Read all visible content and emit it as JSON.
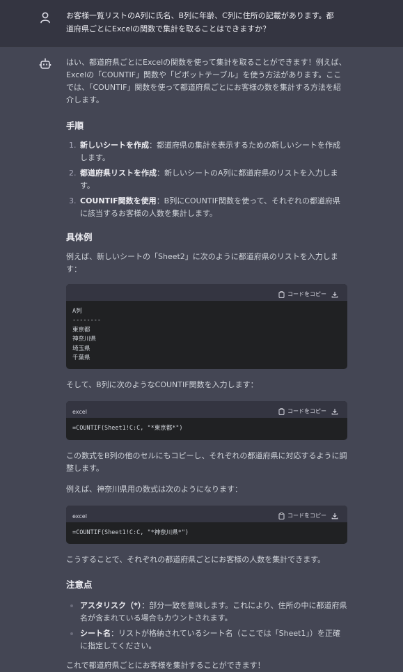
{
  "user_message": {
    "text": "お客様一覧リストのA列に氏名、B列に年齢、C列に住所の記載があります。都道府県ごとにExcelの関数で集計を取ることはできますか？"
  },
  "assistant_message": {
    "intro": "はい、都道府県ごとにExcelの関数を使って集計を取ることができます！例えば、Excelの「COUNTIF」関数や「ピボットテーブル」を使う方法があります。ここでは、「COUNTIF」関数を使って都道府県ごとにお客様の数を集計する方法を紹介します。",
    "steps_heading": "手順",
    "steps": [
      {
        "num": "1.",
        "bold": "新しいシートを作成",
        "text": "：都道府県の集計を表示するための新しいシートを作成します。"
      },
      {
        "num": "2.",
        "bold": "都道府県リストを作成",
        "text": "：新しいシートのA列に都道府県のリストを入力します。"
      },
      {
        "num": "3.",
        "bold": "COUNTIF関数を使用",
        "text": "：B列にCOUNTIF関数を使って、それぞれの都道府県に該当するお客様の人数を集計します。"
      }
    ],
    "example_heading": "具体例",
    "example_intro": "例えば、新しいシートの「Sheet2」に次のように都道府県のリストを入力します：",
    "copy_label": "コードをコピー",
    "code1": "A列\n--------\n東京都\n神奈川県\n埼玉県\n千葉県",
    "para_b": "そして、B列に次のようなCOUNTIF関数を入力します：",
    "code2_lang": "excel",
    "code2": "=COUNTIF(Sheet1!C:C, \"*東京都*\")",
    "para_copy": "この数式をB列の他のセルにもコピーし、それぞれの都道府県に対応するように調整します。",
    "para_kanagawa": "例えば、神奈川県用の数式は次のようになります：",
    "code3_lang": "excel",
    "code3": "=COUNTIF(Sheet1!C:C, \"*神奈川県*\")",
    "para_result": "こうすることで、それぞれの都道府県ごとにお客様の人数を集計できます。",
    "notes_heading": "注意点",
    "notes": [
      {
        "bold": "アスタリスク（*）",
        "text": "：部分一致を意味します。これにより、住所の中に都道府県名が含まれている場合もカウントされます。"
      },
      {
        "bold": "シート名",
        "text": "：リストが格納されているシート名（ここでは「Sheet1」）を正確に指定してください。"
      }
    ],
    "closing": "これで都道府県ごとにお客様を集計することができます！"
  }
}
